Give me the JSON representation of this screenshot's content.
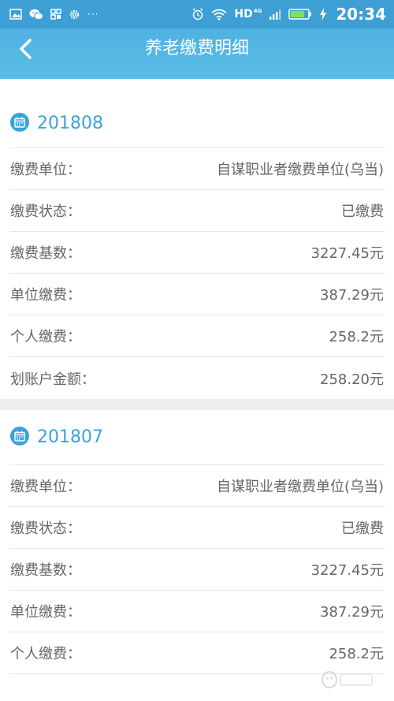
{
  "status_bar": {
    "overflow_dots": "···",
    "network": "HD",
    "network_type": "4G",
    "time": "20:34",
    "left_icons": [
      "gallery-icon",
      "wechat-icon",
      "app-grid-icon",
      "settings-icon"
    ],
    "right_icons": [
      "alarm-icon",
      "wifi-icon",
      "signal-icon",
      "battery-icon",
      "charging-icon"
    ]
  },
  "header": {
    "title": "养老缴费明细",
    "back_icon": "chevron-left-icon"
  },
  "colors": {
    "accent": "#3aa3d8",
    "header": "#4fb1e0",
    "status_bar": "#3d9fd3",
    "label_text": "#666666",
    "separator": "#eeeeee"
  },
  "records": [
    {
      "period": "201808",
      "rows": [
        {
          "label": "缴费单位：",
          "value": "自谋职业者缴费单位(乌当)"
        },
        {
          "label": "缴费状态：",
          "value": "已缴费"
        },
        {
          "label": "缴费基数：",
          "value": "3227.45元"
        },
        {
          "label": "单位缴费：",
          "value": "387.29元"
        },
        {
          "label": "个人缴费：",
          "value": "258.2元"
        },
        {
          "label": "划账户金额：",
          "value": "258.20元"
        }
      ]
    },
    {
      "period": "201807",
      "rows": [
        {
          "label": "缴费单位：",
          "value": "自谋职业者缴费单位(乌当)"
        },
        {
          "label": "缴费状态：",
          "value": "已缴费"
        },
        {
          "label": "缴费基数：",
          "value": "3227.45元"
        },
        {
          "label": "单位缴费：",
          "value": "387.29元"
        },
        {
          "label": "个人缴费：",
          "value": "258.2元"
        }
      ]
    }
  ]
}
